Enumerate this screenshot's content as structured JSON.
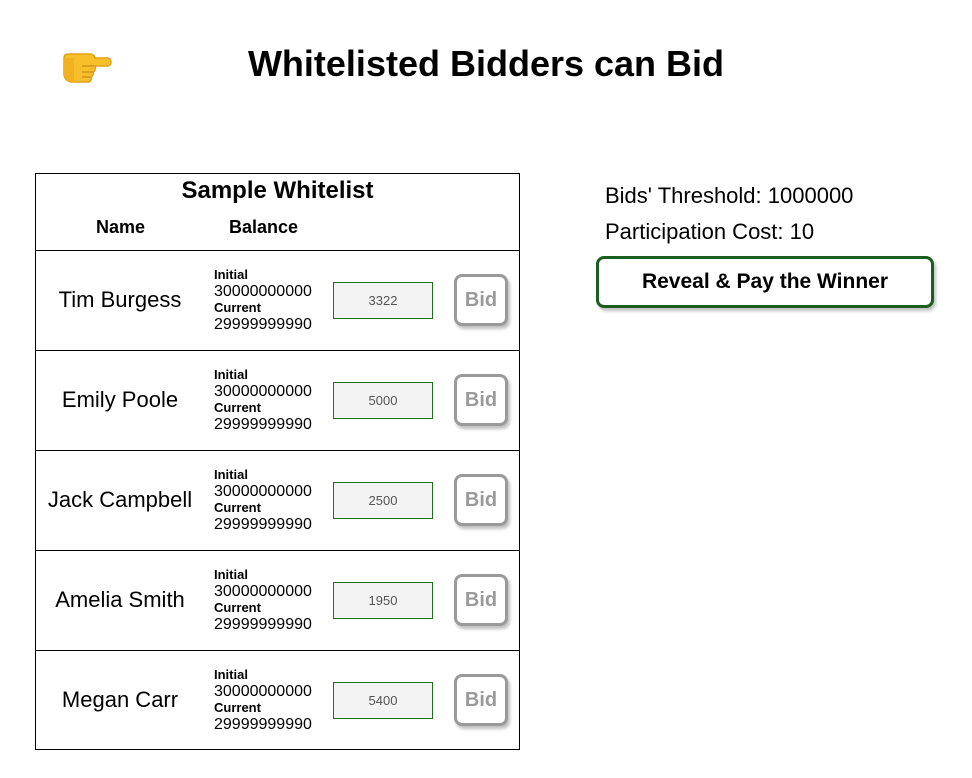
{
  "header": {
    "icon": "pointing-right-hand-icon",
    "title": "Whitelisted Bidders can Bid"
  },
  "whitelist": {
    "title": "Sample Whitelist",
    "columns": {
      "name": "Name",
      "balance": "Balance"
    },
    "initial_label": "Initial",
    "current_label": "Current",
    "bid_button_label": "Bid",
    "bidders": [
      {
        "name": "Tim Burgess",
        "initial": "30000000000",
        "current": "29999999990",
        "bid_value": "3322"
      },
      {
        "name": "Emily Poole",
        "initial": "30000000000",
        "current": "29999999990",
        "bid_value": "5000"
      },
      {
        "name": "Jack Campbell",
        "initial": "30000000000",
        "current": "29999999990",
        "bid_value": "2500"
      },
      {
        "name": "Amelia Smith",
        "initial": "30000000000",
        "current": "29999999990",
        "bid_value": "1950"
      },
      {
        "name": "Megan Carr",
        "initial": "30000000000",
        "current": "29999999990",
        "bid_value": "5400"
      }
    ]
  },
  "auction": {
    "threshold_text": "Bids' Threshold: 1000000",
    "participation_text": "Participation Cost: 10",
    "reveal_button_label": "Reveal & Pay the Winner"
  },
  "colors": {
    "accent_green": "#1b5e20",
    "disabled_gray": "#9a9a9a",
    "input_bg": "#f3f3f3"
  }
}
